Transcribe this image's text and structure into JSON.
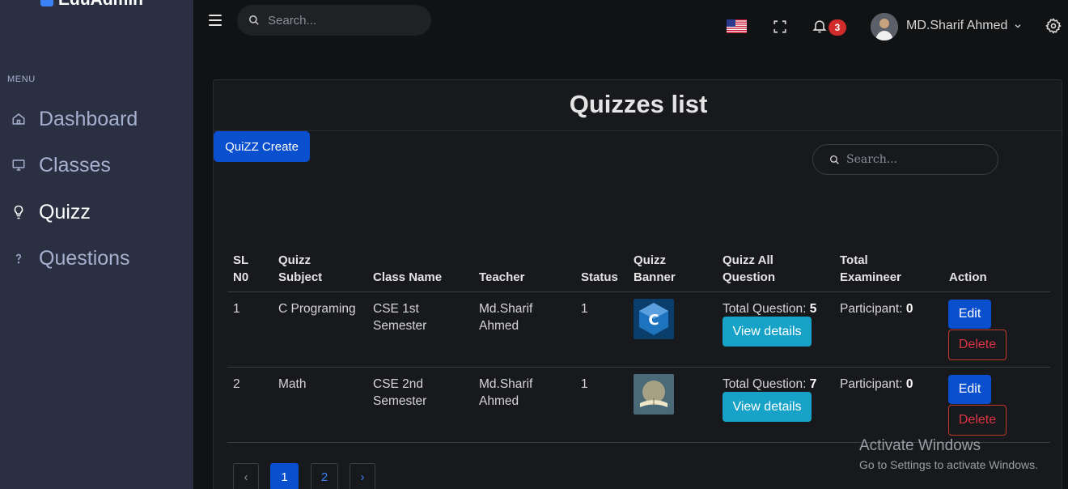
{
  "brand": {
    "name": "EduAdmin"
  },
  "sidebar": {
    "menu_title": "MENU",
    "items": [
      {
        "label": "Dashboard",
        "icon": "home-icon"
      },
      {
        "label": "Classes",
        "icon": "monitor-icon"
      },
      {
        "label": "Quizz",
        "icon": "lightbulb-icon"
      },
      {
        "label": "Questions",
        "icon": "question-icon"
      }
    ],
    "active_item": "Quizz"
  },
  "topbar": {
    "search_placeholder": "Search...",
    "notifications_count": "3",
    "user_name": "MD.Sharif Ahmed",
    "language_flag": "us-flag-icon"
  },
  "page": {
    "title": "Quizzes list",
    "create_button": "QuiZZ Create",
    "search_placeholder": "Search..."
  },
  "table": {
    "headers": {
      "sl": "SL N0",
      "subject": "Quizz Subject",
      "class_name": "Class Name",
      "teacher": "Teacher",
      "status": "Status",
      "banner": "Quizz Banner",
      "all_question": "Quizz All Question",
      "examineer": "Total Examineer",
      "action": "Action"
    },
    "rows": [
      {
        "sl": "1",
        "subject": "C Programing",
        "class_name": "CSE 1st Semester",
        "teacher": "Md.Sharif Ahmed",
        "status": "1",
        "total_question_label": "Total Question:",
        "total_question_value": "5",
        "view_label": "View details",
        "participant_label": "Participant:",
        "participant_value": "0",
        "edit_label": "Edit",
        "delete_label": "Delete"
      },
      {
        "sl": "2",
        "subject": "Math",
        "class_name": "CSE 2nd Semester",
        "teacher": "Md.Sharif Ahmed",
        "status": "1",
        "total_question_label": "Total Question:",
        "total_question_value": "7",
        "view_label": "View details",
        "participant_label": "Participant:",
        "participant_value": "0",
        "edit_label": "Edit",
        "delete_label": "Delete"
      }
    ]
  },
  "pagination": {
    "prev": "‹",
    "pages": [
      "1",
      "2"
    ],
    "next": "›",
    "current": "1"
  },
  "watermark": {
    "title": "Activate Windows",
    "subtitle": "Go to Settings to activate Windows."
  },
  "colors": {
    "sidebar_bg": "#2a3042",
    "primary": "#0a4fce",
    "info": "#17a2c8",
    "danger": "#dc3545",
    "badge": "#d12b2b"
  }
}
